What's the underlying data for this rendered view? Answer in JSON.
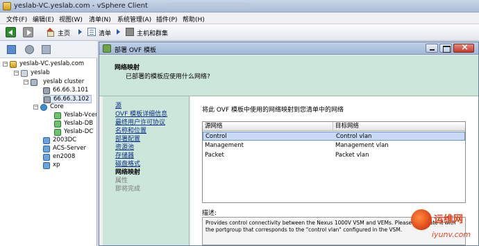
{
  "window": {
    "title": "yeslab-VC.yeslab.com - vSphere Client"
  },
  "menu": [
    "文件(F)",
    "编辑(E)",
    "视图(W)",
    "清单(N)",
    "系统管理(A)",
    "插件(P)",
    "帮助(H)"
  ],
  "breadcrumb": {
    "home": "主页",
    "inventory": "清单",
    "hosts": "主机和群集"
  },
  "tree": {
    "vcenter": "yeslab-VC.yeslab.com",
    "datacenter": "yeslab",
    "cluster": "yeslab cluster",
    "hosts": [
      "66.66.3.101",
      "66.66.3.102"
    ],
    "pool": "Core",
    "pool_vms": [
      "Yeslab-Vcenter",
      "Yeslab-DB",
      "Yeslab-DC"
    ],
    "vms": [
      "2003DC",
      "ACS-Server",
      "en2008",
      "xp"
    ]
  },
  "dialog": {
    "title": "部署 OVF 模板",
    "heading": "网络映射",
    "subheading": "已部署的模板应使用什么网络?",
    "steps": [
      {
        "label": "源",
        "state": "link"
      },
      {
        "label": "OVF 模板详细信息",
        "state": "link"
      },
      {
        "label": "最终用户许可协议",
        "state": "link"
      },
      {
        "label": "名称和位置",
        "state": "link"
      },
      {
        "label": "部署配置",
        "state": "link"
      },
      {
        "label": "资源池",
        "state": "link"
      },
      {
        "label": "存储器",
        "state": "link"
      },
      {
        "label": "磁盘格式",
        "state": "link"
      },
      {
        "label": "网络映射",
        "state": "current"
      },
      {
        "label": "属性",
        "state": "disabled"
      },
      {
        "label": "即将完成",
        "state": "disabled"
      }
    ],
    "instruction": "将此 OVF 模板中使用的网络映射到您清单中的网络",
    "table": {
      "headers": [
        "源网络",
        "目标网络"
      ],
      "rows": [
        {
          "source": "Control",
          "target": "Control vlan",
          "selected": true
        },
        {
          "source": "Management",
          "target": "Management vlan",
          "selected": false
        },
        {
          "source": "Packet",
          "target": "Packet vlan",
          "selected": false
        }
      ]
    },
    "description_label": "描述:",
    "description": "Provides control connectivity between the Nexus 1000V VSM and VEMs. Please associate it with the portgroup that corresponds to the \"control vlan\" configured in the VSM."
  },
  "watermark": {
    "name": "运维网",
    "url": "iyunv.com"
  }
}
